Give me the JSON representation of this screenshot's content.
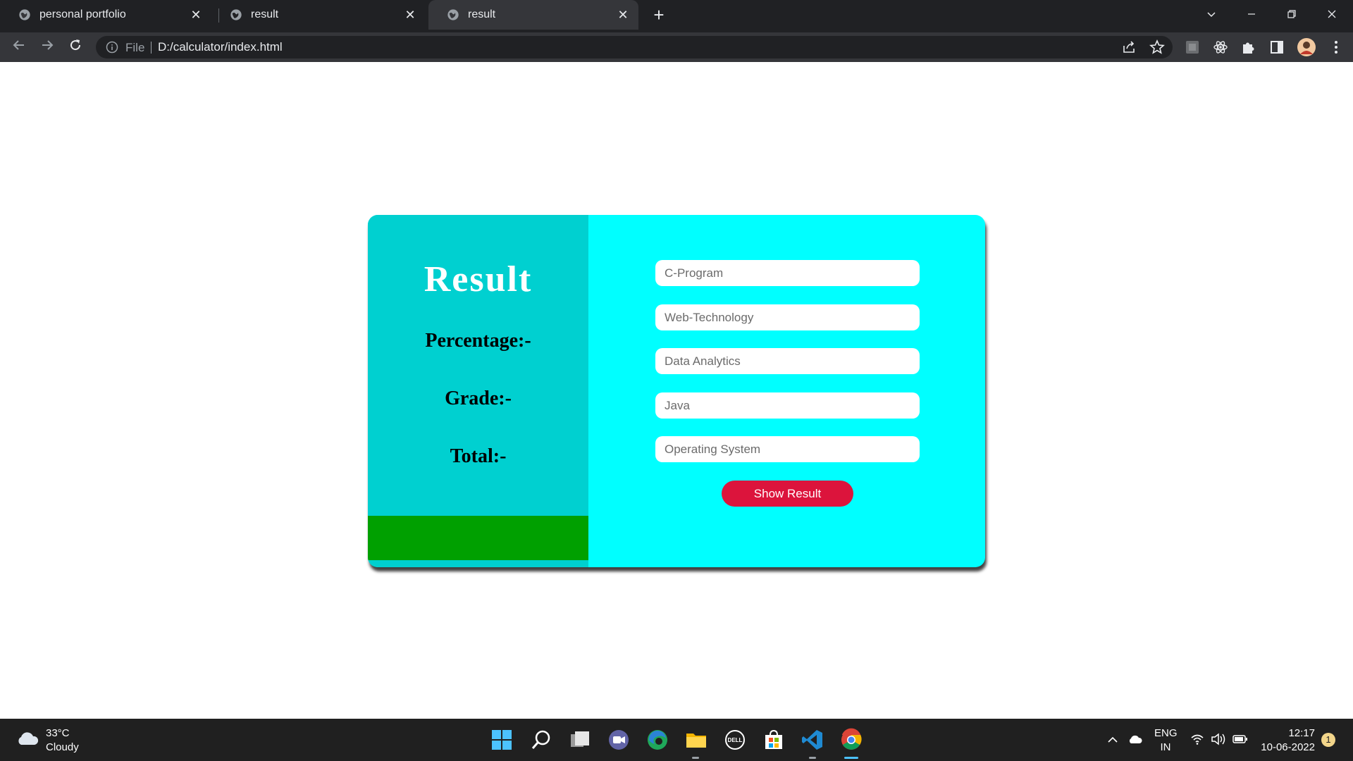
{
  "browser": {
    "tabs": [
      {
        "title": "personal portfolio",
        "active": false
      },
      {
        "title": "result",
        "active": false
      },
      {
        "title": "result",
        "active": true
      }
    ],
    "new_tab_symbol": "+",
    "address": {
      "scheme_label": "File",
      "url": "D:/calculator/index.html"
    }
  },
  "page": {
    "title": "Result",
    "stats": {
      "percentage_label": "Percentage:-",
      "grade_label": "Grade:-",
      "total_label": "Total:-"
    },
    "fields": [
      {
        "placeholder": "C-Program",
        "value": ""
      },
      {
        "placeholder": "Web-Technology",
        "value": ""
      },
      {
        "placeholder": "Data Analytics",
        "value": ""
      },
      {
        "placeholder": "Java",
        "value": ""
      },
      {
        "placeholder": "Operating System",
        "value": ""
      }
    ],
    "button_label": "Show Result",
    "colors": {
      "card_bg": "#00ffff",
      "left_panel": "#00d0d0",
      "green_bar": "#00a000",
      "button": "#dc143c"
    }
  },
  "taskbar": {
    "weather": {
      "temp": "33°C",
      "condition": "Cloudy"
    },
    "language": {
      "line1": "ENG",
      "line2": "IN"
    },
    "clock": {
      "time": "12:17",
      "date": "10-06-2022"
    },
    "notification_count": "1"
  }
}
